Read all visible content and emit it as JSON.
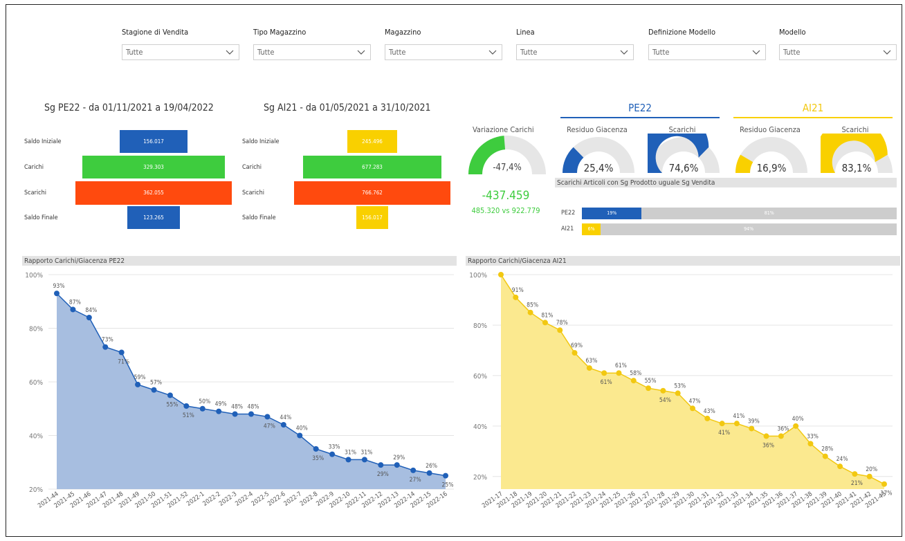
{
  "slicers": [
    {
      "label": "Stagione di Vendita",
      "value": "Tutte"
    },
    {
      "label": "Tipo Magazzino",
      "value": "Tutte"
    },
    {
      "label": "Magazzino",
      "value": "Tutte"
    },
    {
      "label": "Linea",
      "value": "Tutte"
    },
    {
      "label": "Definizione Modello",
      "value": "Tutte"
    },
    {
      "label": "Modello",
      "value": "Tutte"
    }
  ],
  "seasons": {
    "pe22": {
      "title": "Sg PE22 - da 01/11/2021 a 19/04/2022",
      "rows": [
        {
          "label": "Saldo Iniziale",
          "value": "156.017",
          "amount": 156017,
          "color": "#2060b8"
        },
        {
          "label": "Carichi",
          "value": "329.303",
          "amount": 329303,
          "color": "#3ecc3e"
        },
        {
          "label": "Scarichi",
          "value": "362.055",
          "amount": 362055,
          "color": "#ff4a0e"
        },
        {
          "label": "Saldo Finale",
          "value": "123.265",
          "amount": 123265,
          "color": "#2060b8"
        }
      ]
    },
    "ai21": {
      "title": "Sg AI21 - da 01/05/2021 a 31/10/2021",
      "rows": [
        {
          "label": "Saldo Iniziale",
          "value": "245.496",
          "amount": 245496,
          "color": "#f9d000"
        },
        {
          "label": "Carichi",
          "value": "677.283",
          "amount": 677283,
          "color": "#3ecc3e"
        },
        {
          "label": "Scarichi",
          "value": "766.762",
          "amount": 766762,
          "color": "#ff4a0e"
        },
        {
          "label": "Saldo Finale",
          "value": "156.017",
          "amount": 156017,
          "color": "#f9d000"
        }
      ]
    }
  },
  "variazione": {
    "title": "Variazione Carichi",
    "pct_label": "-47,4%",
    "fraction": 0.474,
    "delta": "-437.459",
    "compare": "485.320 vs 922.779",
    "color": "#3ecc3e"
  },
  "sections": {
    "pe22": {
      "label": "PE22",
      "color": "#2060b8"
    },
    "ai21": {
      "label": "AI21",
      "color": "#f9d000"
    }
  },
  "gauges": [
    {
      "title": "Residuo Giacenza",
      "label": "25,4%",
      "fraction": 0.254,
      "color": "#2060b8"
    },
    {
      "title": "Scarichi",
      "label": "74,6%",
      "fraction": 0.746,
      "color": "#2060b8"
    },
    {
      "title": "Residuo Giacenza",
      "label": "16,9%",
      "fraction": 0.169,
      "color": "#f9d000"
    },
    {
      "title": "Scarichi",
      "label": "83,1%",
      "fraction": 0.831,
      "color": "#f9d000"
    }
  ],
  "scarichi_articoli": {
    "title": "Scarichi Articoli con Sg Prodotto uguale Sg Vendita",
    "rows": [
      {
        "label": "PE22",
        "a_label": "19%",
        "a": 0.19,
        "b_label": "81%",
        "color": "#2060b8"
      },
      {
        "label": "AI21",
        "a_label": "6%",
        "a": 0.06,
        "b_label": "94%",
        "color": "#f9d000"
      }
    ]
  },
  "chart_data": [
    {
      "type": "area",
      "title": "Rapporto Carichi/Giacenza PE22",
      "color": "#2060b8",
      "fill": "#a7bee0",
      "ylim": [
        20,
        100
      ],
      "yticks": [
        "20%",
        "40%",
        "60%",
        "80%",
        "100%"
      ],
      "yvals": [
        20,
        40,
        60,
        80,
        100
      ],
      "categories": [
        "2021-44",
        "2021-45",
        "2021-46",
        "2021-47",
        "2021-48",
        "2021-49",
        "2021-50",
        "2021-51",
        "2021-52",
        "2022-1",
        "2022-2",
        "2022-3",
        "2022-4",
        "2022-5",
        "2022-6",
        "2022-7",
        "2022-8",
        "2022-9",
        "2022-10",
        "2022-11",
        "2022-12",
        "2022-13",
        "2022-14",
        "2022-15",
        "2022-16"
      ],
      "values": [
        93,
        87,
        84,
        73,
        71,
        59,
        57,
        55,
        51,
        50,
        49,
        48,
        48,
        47,
        44,
        40,
        35,
        33,
        31,
        31,
        29,
        29,
        27,
        26,
        25
      ],
      "labels": [
        "93%",
        "87%",
        "84%",
        "73%",
        "71%",
        "59%",
        "57%",
        "55%",
        "51%",
        "50%",
        "49%",
        "48%",
        "48%",
        "47%",
        "44%",
        "40%",
        "35%",
        "33%",
        "31%",
        "31%",
        "29%",
        "29%",
        "27%",
        "26%",
        "25%"
      ],
      "label_pos": [
        "a",
        "a",
        "a",
        "a",
        "b",
        "a",
        "a",
        "b",
        "b",
        "a",
        "a",
        "a",
        "a",
        "b",
        "a",
        "a",
        "b",
        "a",
        "a",
        "a",
        "b",
        "a",
        "b",
        "a",
        "b"
      ]
    },
    {
      "type": "area",
      "title": "Rapporto Carichi/Giacenza AI21",
      "color": "#f2c811",
      "fill": "#fbe98f",
      "ylim": [
        15,
        100
      ],
      "yticks": [
        "20%",
        "40%",
        "60%",
        "80%",
        "100%"
      ],
      "yvals": [
        20,
        40,
        60,
        80,
        100
      ],
      "categories": [
        "2021-17",
        "2021-18",
        "2021-19",
        "2021-20",
        "2021-21",
        "2021-22",
        "2021-23",
        "2021-24",
        "2021-25",
        "2021-26",
        "2021-27",
        "2021-28",
        "2021-29",
        "2021-30",
        "2021-31",
        "2021-32",
        "2021-33",
        "2021-34",
        "2021-35",
        "2021-36",
        "2021-37",
        "2021-38",
        "2021-39",
        "2021-40",
        "2021-41",
        "2021-42",
        "2021-43"
      ],
      "values": [
        100,
        91,
        85,
        81,
        78,
        69,
        63,
        61,
        61,
        58,
        55,
        54,
        53,
        47,
        43,
        41,
        41,
        39,
        36,
        36,
        40,
        33,
        28,
        24,
        21,
        20,
        17
      ],
      "labels": [
        "",
        "91%",
        "85%",
        "81%",
        "78%",
        "69%",
        "63%",
        "61%",
        "61%",
        "58%",
        "55%",
        "54%",
        "53%",
        "47%",
        "43%",
        "41%",
        "41%",
        "39%",
        "36%",
        "36%",
        "40%",
        "33%",
        "28%",
        "24%",
        "21%",
        "20%",
        "17%"
      ],
      "label_pos": [
        "a",
        "a",
        "a",
        "a",
        "a",
        "a",
        "a",
        "b",
        "a",
        "a",
        "a",
        "b",
        "a",
        "a",
        "a",
        "b",
        "a",
        "a",
        "b",
        "a",
        "a",
        "a",
        "a",
        "a",
        "b",
        "a",
        "b"
      ]
    }
  ]
}
